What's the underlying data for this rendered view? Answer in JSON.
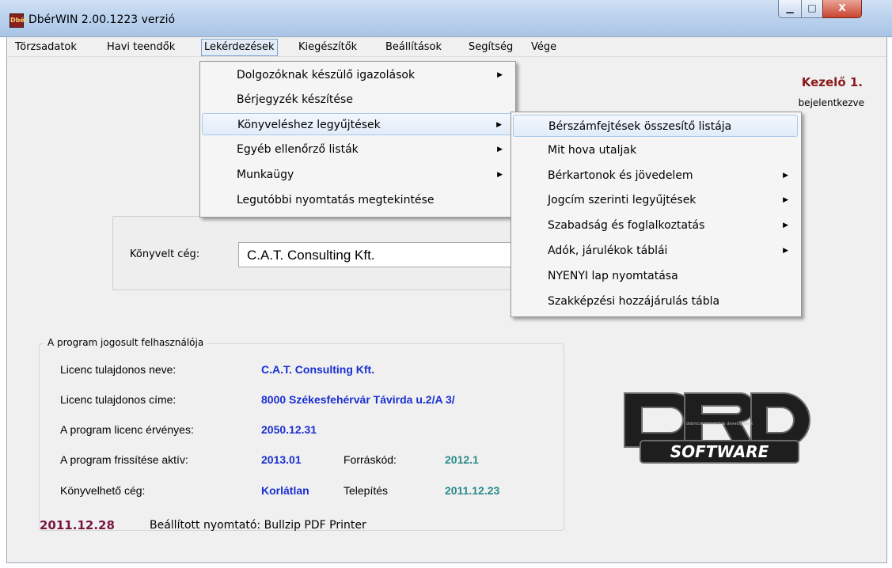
{
  "window": {
    "title": "DbérWIN 2.00.1223 verzió",
    "icon_text": "Dbér",
    "min_glyph": "▁",
    "max_glyph": "□",
    "close_glyph": "X"
  },
  "menubar": [
    {
      "label": "Törzsadatok"
    },
    {
      "label": "Havi teendők"
    },
    {
      "label": "Lekérdezések"
    },
    {
      "label": "Kiegészítők"
    },
    {
      "label": "Beállítások"
    },
    {
      "label": "Segítség"
    },
    {
      "label": "Vége"
    }
  ],
  "operator": {
    "name": "Kezelő 1.",
    "status": "bejelentkezve"
  },
  "company": {
    "label": "Könyvelt cég:",
    "value": "C.A.T. Consulting Kft."
  },
  "license": {
    "legend": "A program jogosult felhasználója",
    "owner_name_label": "Licenc tulajdonos neve:",
    "owner_name": "C.A.T. Consulting Kft.",
    "owner_address_label": "Licenc tulajdonos címe:",
    "owner_address": "8000 Székesfehérvár Távirda u.2/A 3/",
    "valid_label": "A program licenc érvényes:",
    "valid_until": "2050.12.31",
    "update_label": "A program frissítése aktív:",
    "update_value": "2013.01",
    "source_label": "Forráskód:",
    "source_value": "2012.1",
    "companies_label": "Könyvelhető cég:",
    "companies_value": "Korlátlan",
    "install_label": "Telepítés",
    "install_value": "2011.12.23"
  },
  "logo": {
    "text": "SOFTWARE",
    "tagline": "dobrocsi research & development"
  },
  "footer": {
    "date": "2011.12.28",
    "printer_label": "Beállított nyomtató: Bullzip PDF Printer"
  },
  "menu_lekerdezesek": [
    {
      "label": "Dolgozóknak készülő igazolások",
      "submenu": true
    },
    {
      "label": "Bérjegyzék készítése",
      "submenu": false
    },
    {
      "label": "Könyveléshez legyűjtések",
      "submenu": true,
      "active": true
    },
    {
      "label": "Egyéb ellenőrző listák",
      "submenu": true
    },
    {
      "label": "Munkaügy",
      "submenu": true
    },
    {
      "label": "Legutóbbi nyomtatás megtekintése",
      "submenu": false
    }
  ],
  "menu_konyveles": [
    {
      "label": "Bérszámfejtések összesítő listája",
      "submenu": false,
      "active": true
    },
    {
      "label": "Mit hova utaljak",
      "submenu": false
    },
    {
      "label": "Bérkartonok és jövedelem",
      "submenu": true
    },
    {
      "label": "Jogcím szerinti legyűjtések",
      "submenu": true
    },
    {
      "label": "Szabadság és foglalkoztatás",
      "submenu": true
    },
    {
      "label": "Adók, járulékok táblái",
      "submenu": true
    },
    {
      "label": "NYENYI lap nyomtatása",
      "submenu": false
    },
    {
      "label": "Szakképzési hozzájárulás tábla",
      "submenu": false
    }
  ],
  "colors": {
    "operator": "#8a1a1a",
    "license_value": "#1a2fd1",
    "license_teal": "#2a8a8a",
    "footer_date": "#7a1540"
  }
}
